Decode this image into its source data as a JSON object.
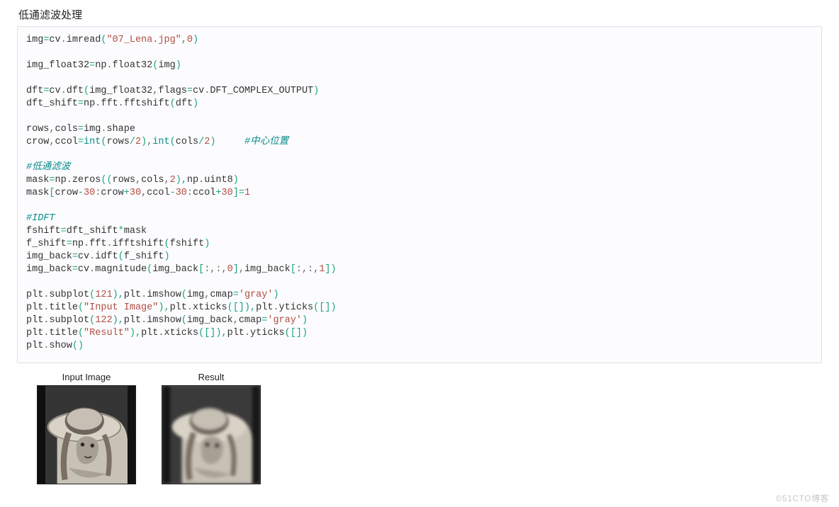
{
  "section_title": "低通滤波处理",
  "watermark": "©51CTO博客",
  "plots": {
    "left_title": "Input Image",
    "right_title": "Result"
  },
  "code": [
    [
      [
        "img",
        "ident"
      ],
      [
        "=",
        "green"
      ],
      [
        "cv",
        "ident"
      ],
      [
        ".",
        "punc"
      ],
      [
        "imread",
        "ident"
      ],
      [
        "(",
        "green"
      ],
      [
        "\"07_Lena.jpg\"",
        "str"
      ],
      [
        ",",
        "punc"
      ],
      [
        "0",
        "num"
      ],
      [
        ")",
        "green"
      ]
    ],
    [],
    [
      [
        "img_float32",
        "ident"
      ],
      [
        "=",
        "green"
      ],
      [
        "np",
        "ident"
      ],
      [
        ".",
        "punc"
      ],
      [
        "float32",
        "ident"
      ],
      [
        "(",
        "green"
      ],
      [
        "img",
        "ident"
      ],
      [
        ")",
        "green"
      ]
    ],
    [],
    [
      [
        "dft",
        "ident"
      ],
      [
        "=",
        "green"
      ],
      [
        "cv",
        "ident"
      ],
      [
        ".",
        "punc"
      ],
      [
        "dft",
        "ident"
      ],
      [
        "(",
        "green"
      ],
      [
        "img_float32",
        "ident"
      ],
      [
        ",",
        "punc"
      ],
      [
        "flags",
        "ident"
      ],
      [
        "=",
        "green"
      ],
      [
        "cv",
        "ident"
      ],
      [
        ".",
        "punc"
      ],
      [
        "DFT_COMPLEX_OUTPUT",
        "ident"
      ],
      [
        ")",
        "green"
      ]
    ],
    [
      [
        "dft_shift",
        "ident"
      ],
      [
        "=",
        "green"
      ],
      [
        "np",
        "ident"
      ],
      [
        ".",
        "punc"
      ],
      [
        "fft",
        "ident"
      ],
      [
        ".",
        "punc"
      ],
      [
        "fftshift",
        "ident"
      ],
      [
        "(",
        "green"
      ],
      [
        "dft",
        "ident"
      ],
      [
        ")",
        "green"
      ]
    ],
    [],
    [
      [
        "rows",
        "ident"
      ],
      [
        ",",
        "punc"
      ],
      [
        "cols",
        "ident"
      ],
      [
        "=",
        "green"
      ],
      [
        "img",
        "ident"
      ],
      [
        ".",
        "punc"
      ],
      [
        "shape",
        "ident"
      ]
    ],
    [
      [
        "crow",
        "ident"
      ],
      [
        ",",
        "punc"
      ],
      [
        "ccol",
        "ident"
      ],
      [
        "=",
        "green"
      ],
      [
        "int",
        "teal"
      ],
      [
        "(",
        "green"
      ],
      [
        "rows",
        "ident"
      ],
      [
        "/",
        "green"
      ],
      [
        "2",
        "num"
      ],
      [
        ")",
        "green"
      ],
      [
        ",",
        "punc"
      ],
      [
        "int",
        "teal"
      ],
      [
        "(",
        "green"
      ],
      [
        "cols",
        "ident"
      ],
      [
        "/",
        "green"
      ],
      [
        "2",
        "num"
      ],
      [
        ")",
        "green"
      ],
      [
        "     ",
        "ident"
      ],
      [
        "#中心位置",
        "cmt"
      ]
    ],
    [],
    [
      [
        "#低通滤波",
        "cmt-g"
      ]
    ],
    [
      [
        "mask",
        "ident"
      ],
      [
        "=",
        "green"
      ],
      [
        "np",
        "ident"
      ],
      [
        ".",
        "punc"
      ],
      [
        "zeros",
        "ident"
      ],
      [
        "((",
        "green"
      ],
      [
        "rows",
        "ident"
      ],
      [
        ",",
        "punc"
      ],
      [
        "cols",
        "ident"
      ],
      [
        ",",
        "punc"
      ],
      [
        "2",
        "num"
      ],
      [
        "),",
        "green"
      ],
      [
        "np",
        "ident"
      ],
      [
        ".",
        "punc"
      ],
      [
        "uint8",
        "ident"
      ],
      [
        ")",
        "green"
      ]
    ],
    [
      [
        "mask",
        "ident"
      ],
      [
        "[",
        "green"
      ],
      [
        "crow",
        "ident"
      ],
      [
        "-",
        "green"
      ],
      [
        "30",
        "num"
      ],
      [
        ":",
        "punc"
      ],
      [
        "crow",
        "ident"
      ],
      [
        "+",
        "green"
      ],
      [
        "30",
        "num"
      ],
      [
        ",",
        "punc"
      ],
      [
        "ccol",
        "ident"
      ],
      [
        "-",
        "green"
      ],
      [
        "30",
        "num"
      ],
      [
        ":",
        "punc"
      ],
      [
        "ccol",
        "ident"
      ],
      [
        "+",
        "green"
      ],
      [
        "30",
        "num"
      ],
      [
        "]",
        "green"
      ],
      [
        "=",
        "green"
      ],
      [
        "1",
        "num"
      ]
    ],
    [],
    [
      [
        "#IDFT",
        "cmt-g"
      ]
    ],
    [
      [
        "fshift",
        "ident"
      ],
      [
        "=",
        "green"
      ],
      [
        "dft_shift",
        "ident"
      ],
      [
        "*",
        "green"
      ],
      [
        "mask",
        "ident"
      ]
    ],
    [
      [
        "f_shift",
        "ident"
      ],
      [
        "=",
        "green"
      ],
      [
        "np",
        "ident"
      ],
      [
        ".",
        "punc"
      ],
      [
        "fft",
        "ident"
      ],
      [
        ".",
        "punc"
      ],
      [
        "ifftshift",
        "ident"
      ],
      [
        "(",
        "green"
      ],
      [
        "fshift",
        "ident"
      ],
      [
        ")",
        "green"
      ]
    ],
    [
      [
        "img_back",
        "ident"
      ],
      [
        "=",
        "green"
      ],
      [
        "cv",
        "ident"
      ],
      [
        ".",
        "punc"
      ],
      [
        "idft",
        "ident"
      ],
      [
        "(",
        "green"
      ],
      [
        "f_shift",
        "ident"
      ],
      [
        ")",
        "green"
      ]
    ],
    [
      [
        "img_back",
        "ident"
      ],
      [
        "=",
        "green"
      ],
      [
        "cv",
        "ident"
      ],
      [
        ".",
        "punc"
      ],
      [
        "magnitude",
        "ident"
      ],
      [
        "(",
        "green"
      ],
      [
        "img_back",
        "ident"
      ],
      [
        "[",
        "green"
      ],
      [
        ":",
        "punc"
      ],
      [
        ",",
        "punc"
      ],
      [
        ":",
        "punc"
      ],
      [
        ",",
        "punc"
      ],
      [
        "0",
        "num"
      ],
      [
        "]",
        "green"
      ],
      [
        ",",
        "punc"
      ],
      [
        "img_back",
        "ident"
      ],
      [
        "[",
        "green"
      ],
      [
        ":",
        "punc"
      ],
      [
        ",",
        "punc"
      ],
      [
        ":",
        "punc"
      ],
      [
        ",",
        "punc"
      ],
      [
        "1",
        "num"
      ],
      [
        "])",
        "green"
      ]
    ],
    [],
    [
      [
        "plt",
        "ident"
      ],
      [
        ".",
        "punc"
      ],
      [
        "subplot",
        "ident"
      ],
      [
        "(",
        "green"
      ],
      [
        "121",
        "num"
      ],
      [
        "),",
        "green"
      ],
      [
        "plt",
        "ident"
      ],
      [
        ".",
        "punc"
      ],
      [
        "imshow",
        "ident"
      ],
      [
        "(",
        "green"
      ],
      [
        "img",
        "ident"
      ],
      [
        ",",
        "punc"
      ],
      [
        "cmap",
        "ident"
      ],
      [
        "=",
        "green"
      ],
      [
        "'gray'",
        "str"
      ],
      [
        ")",
        "green"
      ]
    ],
    [
      [
        "plt",
        "ident"
      ],
      [
        ".",
        "punc"
      ],
      [
        "title",
        "ident"
      ],
      [
        "(",
        "green"
      ],
      [
        "\"Input Image\"",
        "str"
      ],
      [
        "),",
        "green"
      ],
      [
        "plt",
        "ident"
      ],
      [
        ".",
        "punc"
      ],
      [
        "xticks",
        "ident"
      ],
      [
        "([]),",
        "green"
      ],
      [
        "plt",
        "ident"
      ],
      [
        ".",
        "punc"
      ],
      [
        "yticks",
        "ident"
      ],
      [
        "([])",
        "green"
      ]
    ],
    [
      [
        "plt",
        "ident"
      ],
      [
        ".",
        "punc"
      ],
      [
        "subplot",
        "ident"
      ],
      [
        "(",
        "green"
      ],
      [
        "122",
        "num"
      ],
      [
        "),",
        "green"
      ],
      [
        "plt",
        "ident"
      ],
      [
        ".",
        "punc"
      ],
      [
        "imshow",
        "ident"
      ],
      [
        "(",
        "green"
      ],
      [
        "img_back",
        "ident"
      ],
      [
        ",",
        "punc"
      ],
      [
        "cmap",
        "ident"
      ],
      [
        "=",
        "green"
      ],
      [
        "'gray'",
        "str"
      ],
      [
        ")",
        "green"
      ]
    ],
    [
      [
        "plt",
        "ident"
      ],
      [
        ".",
        "punc"
      ],
      [
        "title",
        "ident"
      ],
      [
        "(",
        "green"
      ],
      [
        "\"Result\"",
        "str"
      ],
      [
        "),",
        "green"
      ],
      [
        "plt",
        "ident"
      ],
      [
        ".",
        "punc"
      ],
      [
        "xticks",
        "ident"
      ],
      [
        "([]),",
        "green"
      ],
      [
        "plt",
        "ident"
      ],
      [
        ".",
        "punc"
      ],
      [
        "yticks",
        "ident"
      ],
      [
        "([])",
        "green"
      ]
    ],
    [
      [
        "plt",
        "ident"
      ],
      [
        ".",
        "punc"
      ],
      [
        "show",
        "ident"
      ],
      [
        "()",
        "green"
      ]
    ]
  ]
}
